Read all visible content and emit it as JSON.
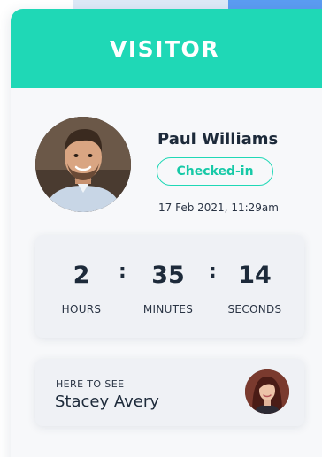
{
  "card": {
    "title": "VISITOR"
  },
  "visitor": {
    "name": "Paul Williams",
    "status": "Checked-in",
    "checkin_time": "17 Feb 2021, 11:29am",
    "avatar_icon": "person-photo"
  },
  "timer": {
    "units": [
      {
        "value": "2",
        "label": "HOURS"
      },
      {
        "value": "35",
        "label": "MINUTES"
      },
      {
        "value": "14",
        "label": "SECONDS"
      }
    ],
    "separator": ":"
  },
  "host": {
    "label": "HERE TO SEE",
    "name": "Stacey Avery",
    "avatar_icon": "person-photo"
  },
  "colors": {
    "accent": "#1fd8b6",
    "text_dark": "#1d2a3a",
    "panel": "#eff1f5"
  }
}
